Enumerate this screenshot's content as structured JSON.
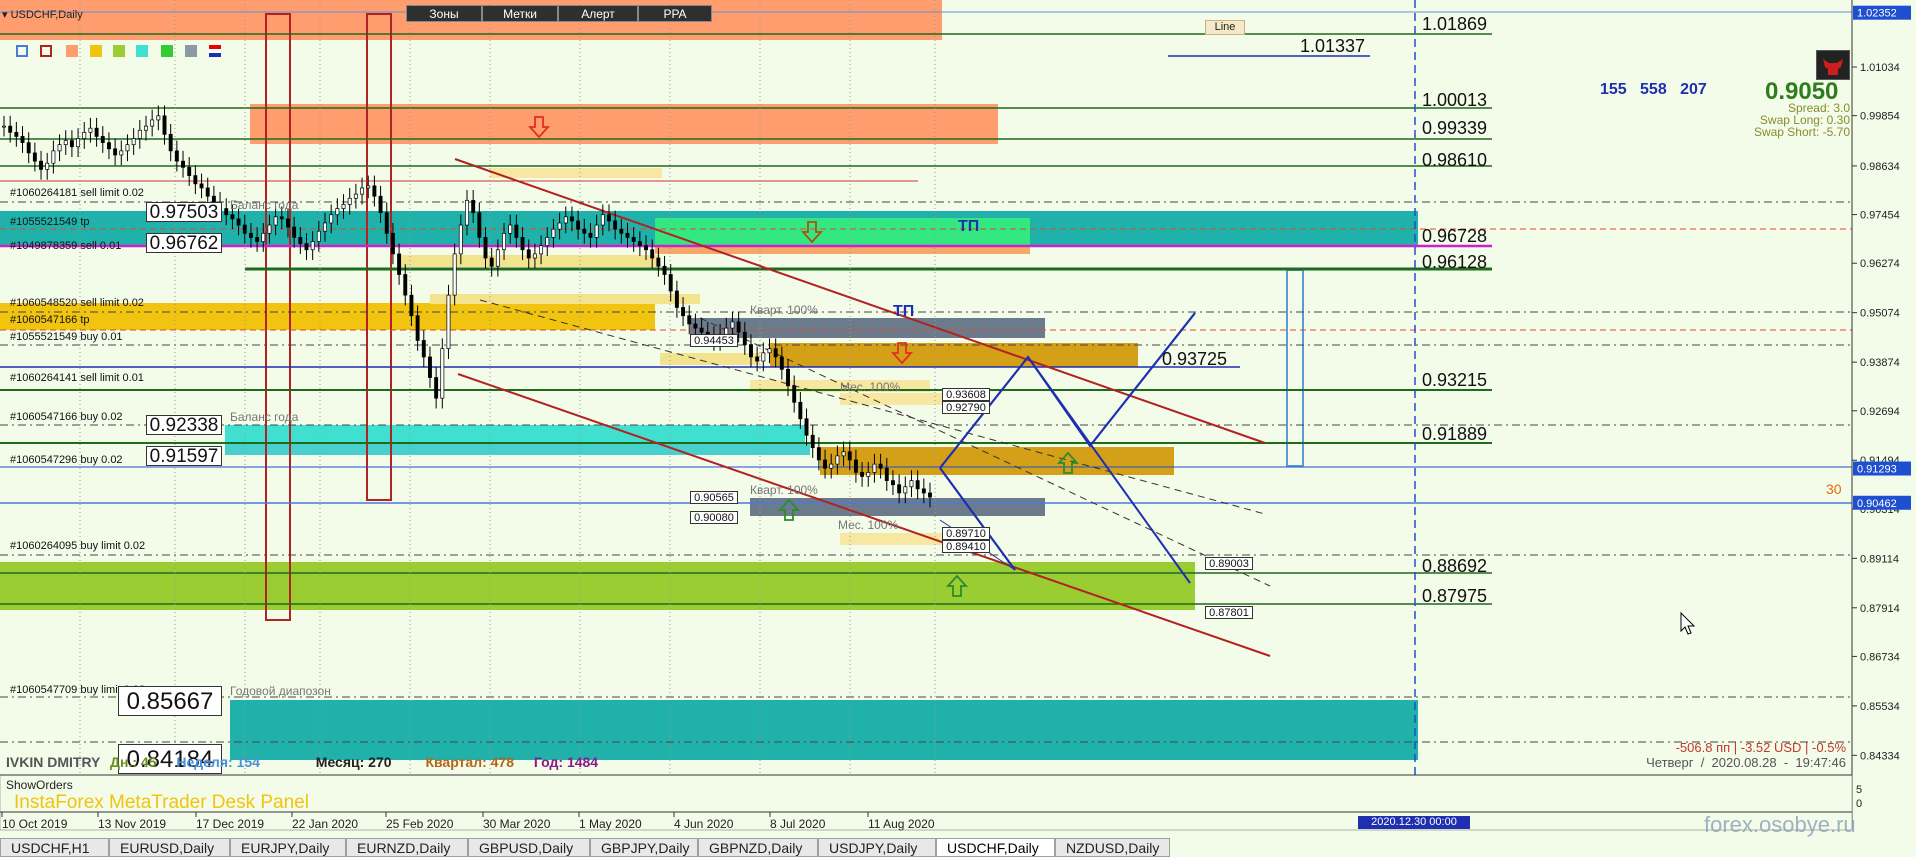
{
  "window": {
    "symbol_title": "USDCHF,Daily",
    "price_big": "0.9050",
    "counters": "155   558   207",
    "spread": "Spread: 3.0",
    "swap_long": "Swap Long: 0.30",
    "swap_short": "Swap Short: -5.70"
  },
  "toolbar": [
    "Зоны",
    "Метки",
    "Алерт",
    "PPA"
  ],
  "line_label": "Line",
  "chart_data": {
    "type": "candlestick",
    "symbol": "USDCHF",
    "timeframe": "Daily",
    "ylim": [
      0.8393,
      1.0266
    ],
    "y_ticks": [
      "1.01034",
      "0.99854",
      "0.98634",
      "0.97454",
      "0.96274",
      "0.95074",
      "0.93874",
      "0.92694",
      "0.91494",
      "0.90314",
      "0.89114",
      "0.87914",
      "0.86734",
      "0.85534",
      "0.84334"
    ],
    "x_ticks": [
      "10 Oct 2019",
      "13 Nov 2019",
      "17 Dec 2019",
      "22 Jan 2020",
      "25 Feb 2020",
      "30 Mar 2020",
      "1 May 2020",
      "4 Jun 2020",
      "8 Jul 2020",
      "11 Aug 2020"
    ],
    "price_badges": [
      {
        "label": "1.02352",
        "color": "#1f4fd1"
      },
      {
        "label": "0.91293",
        "color": "#1f4fd1"
      },
      {
        "label": "0.90462",
        "color": "#1f4fd1"
      }
    ],
    "level_labels": [
      "1.01869",
      "1.01337",
      "1.00013",
      "0.99339",
      "0.98610",
      "0.96728",
      "0.96128",
      "0.93725",
      "0.93215",
      "0.91889",
      "0.88692",
      "0.87975"
    ],
    "small_boxes": [
      "0.93608",
      "0.92790",
      "0.89710",
      "0.89410",
      "0.89003",
      "0.87801",
      "0.90565",
      "0.90080",
      "0.94453"
    ],
    "order_labels": [
      "#1060264181 sell limit 0.02",
      "#1055521549 tp",
      "#1049878359 sell 0.01",
      "#1060548520 sell limit 0.02",
      "#1060547166 tp",
      "#1055521549 buy 0.01",
      "#1060264141 sell limit 0.01",
      "#1060547166 buy 0.02",
      "#1060547296 buy 0.02",
      "#1060264095 buy limit 0.02",
      "#1060547709 buy limit 0.02"
    ],
    "left_boxes": [
      "0.97503",
      "0.96762",
      "0.92338",
      "0.91597",
      "0.85667",
      "0.84184"
    ],
    "zone_texts": [
      "Баланс года",
      "Баланс года",
      "Годовой диапозон",
      "Кварт. 100%",
      "Мес. 100%",
      "Кварт. 100%",
      "Мес. 100%",
      "ТП",
      "ТП",
      "30"
    ],
    "date_badge": "2020.12.30 00:00"
  },
  "stats": {
    "name": "IVKIN DMITRY",
    "day": "Дн.: 45",
    "week": "Неделя: 154",
    "month": "Месяц: 270",
    "quarter": "Квартал: 478",
    "year": "Год: 1484",
    "pnl": "-506.8 пп | -3.52 USD | -0.5%",
    "datetime": "Четверг  /  2020.08.28  -  19:47:46"
  },
  "panel": {
    "show_orders": "ShowOrders",
    "desk_title": "InstaForex MetaTrader Desk Panel"
  },
  "subwindow": {
    "y_ticks": [
      "5",
      "0"
    ]
  },
  "watermark": "forex.osobye.ru",
  "tabs": [
    "USDCHF,H1",
    "EURUSD,Daily",
    "EURJPY,Daily",
    "EURNZD,Daily",
    "GBPUSD,Daily",
    "GBPJPY,Daily",
    "GBPNZD,Daily",
    "USDJPY,Daily",
    "USDCHF,Daily",
    "NZDUSD,Daily"
  ],
  "active_tab": 8,
  "colors": {
    "background": "#f3fbe9",
    "sell_zone": "#ff9966",
    "buy_zone": "#9acd32",
    "teal_zone": "#20b2aa",
    "gold_zone": "#d4a017",
    "grid_green": "#1e6b1e"
  }
}
